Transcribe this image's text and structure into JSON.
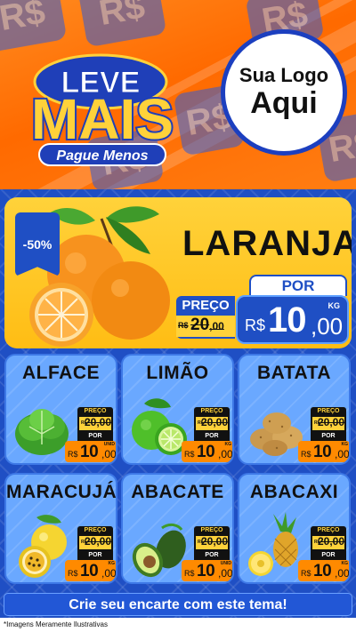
{
  "header": {
    "brand_top": "LEVE",
    "brand_main": "MAIS",
    "brand_sub": "Pague Menos",
    "logo_line1": "Sua Logo",
    "logo_line2": "Aqui",
    "bg_symbol": "R$"
  },
  "featured": {
    "name": "LARANJA",
    "discount": "-50%",
    "old_label": "PREÇO",
    "old_currency": "R$",
    "old_int": "20",
    "old_cents": ",00",
    "por_label": "POR",
    "currency": "R$",
    "price_int": "10",
    "price_cents": ",00",
    "unit": "KG"
  },
  "products": [
    {
      "name": "ALFACE",
      "icon": "lettuce-icon",
      "old_label": "PREÇO",
      "old_currency": "R$",
      "old_price": "20,00",
      "por_label": "POR",
      "currency": "R$",
      "price_int": "10",
      "price_cents": ",00",
      "unit": "UNID"
    },
    {
      "name": "LIMÃO",
      "icon": "lemon-icon",
      "old_label": "PREÇO",
      "old_currency": "R$",
      "old_price": "20,00",
      "por_label": "POR",
      "currency": "R$",
      "price_int": "10",
      "price_cents": ",00",
      "unit": "KG"
    },
    {
      "name": "BATATA",
      "icon": "potato-icon",
      "old_label": "PREÇO",
      "old_currency": "R$",
      "old_price": "20,00",
      "por_label": "POR",
      "currency": "R$",
      "price_int": "10",
      "price_cents": ",00",
      "unit": "KG"
    },
    {
      "name": "MARACUJÁ",
      "icon": "passion-fruit-icon",
      "old_label": "PREÇO",
      "old_currency": "R$",
      "old_price": "20,00",
      "por_label": "POR",
      "currency": "R$",
      "price_int": "10",
      "price_cents": ",00",
      "unit": "KG"
    },
    {
      "name": "ABACATE",
      "icon": "avocado-icon",
      "old_label": "PREÇO",
      "old_currency": "R$",
      "old_price": "20,00",
      "por_label": "POR",
      "currency": "R$",
      "price_int": "10",
      "price_cents": ",00",
      "unit": "UNID"
    },
    {
      "name": "ABACAXI",
      "icon": "pineapple-icon",
      "old_label": "PREÇO",
      "old_currency": "R$",
      "old_price": "20,00",
      "por_label": "POR",
      "currency": "R$",
      "price_int": "10",
      "price_cents": ",00",
      "unit": "KG"
    }
  ],
  "footer": {
    "cta": "Crie seu encarte com este tema!",
    "disclaimer": "*Imagens Meramente Ilustrativas"
  },
  "colors": {
    "header_orange": "#ff6a00",
    "brand_blue": "#1f4fc4",
    "featured_yellow": "#ffd23a",
    "card_blue": "#6aa8ff",
    "price_orange": "#ff8a00"
  }
}
